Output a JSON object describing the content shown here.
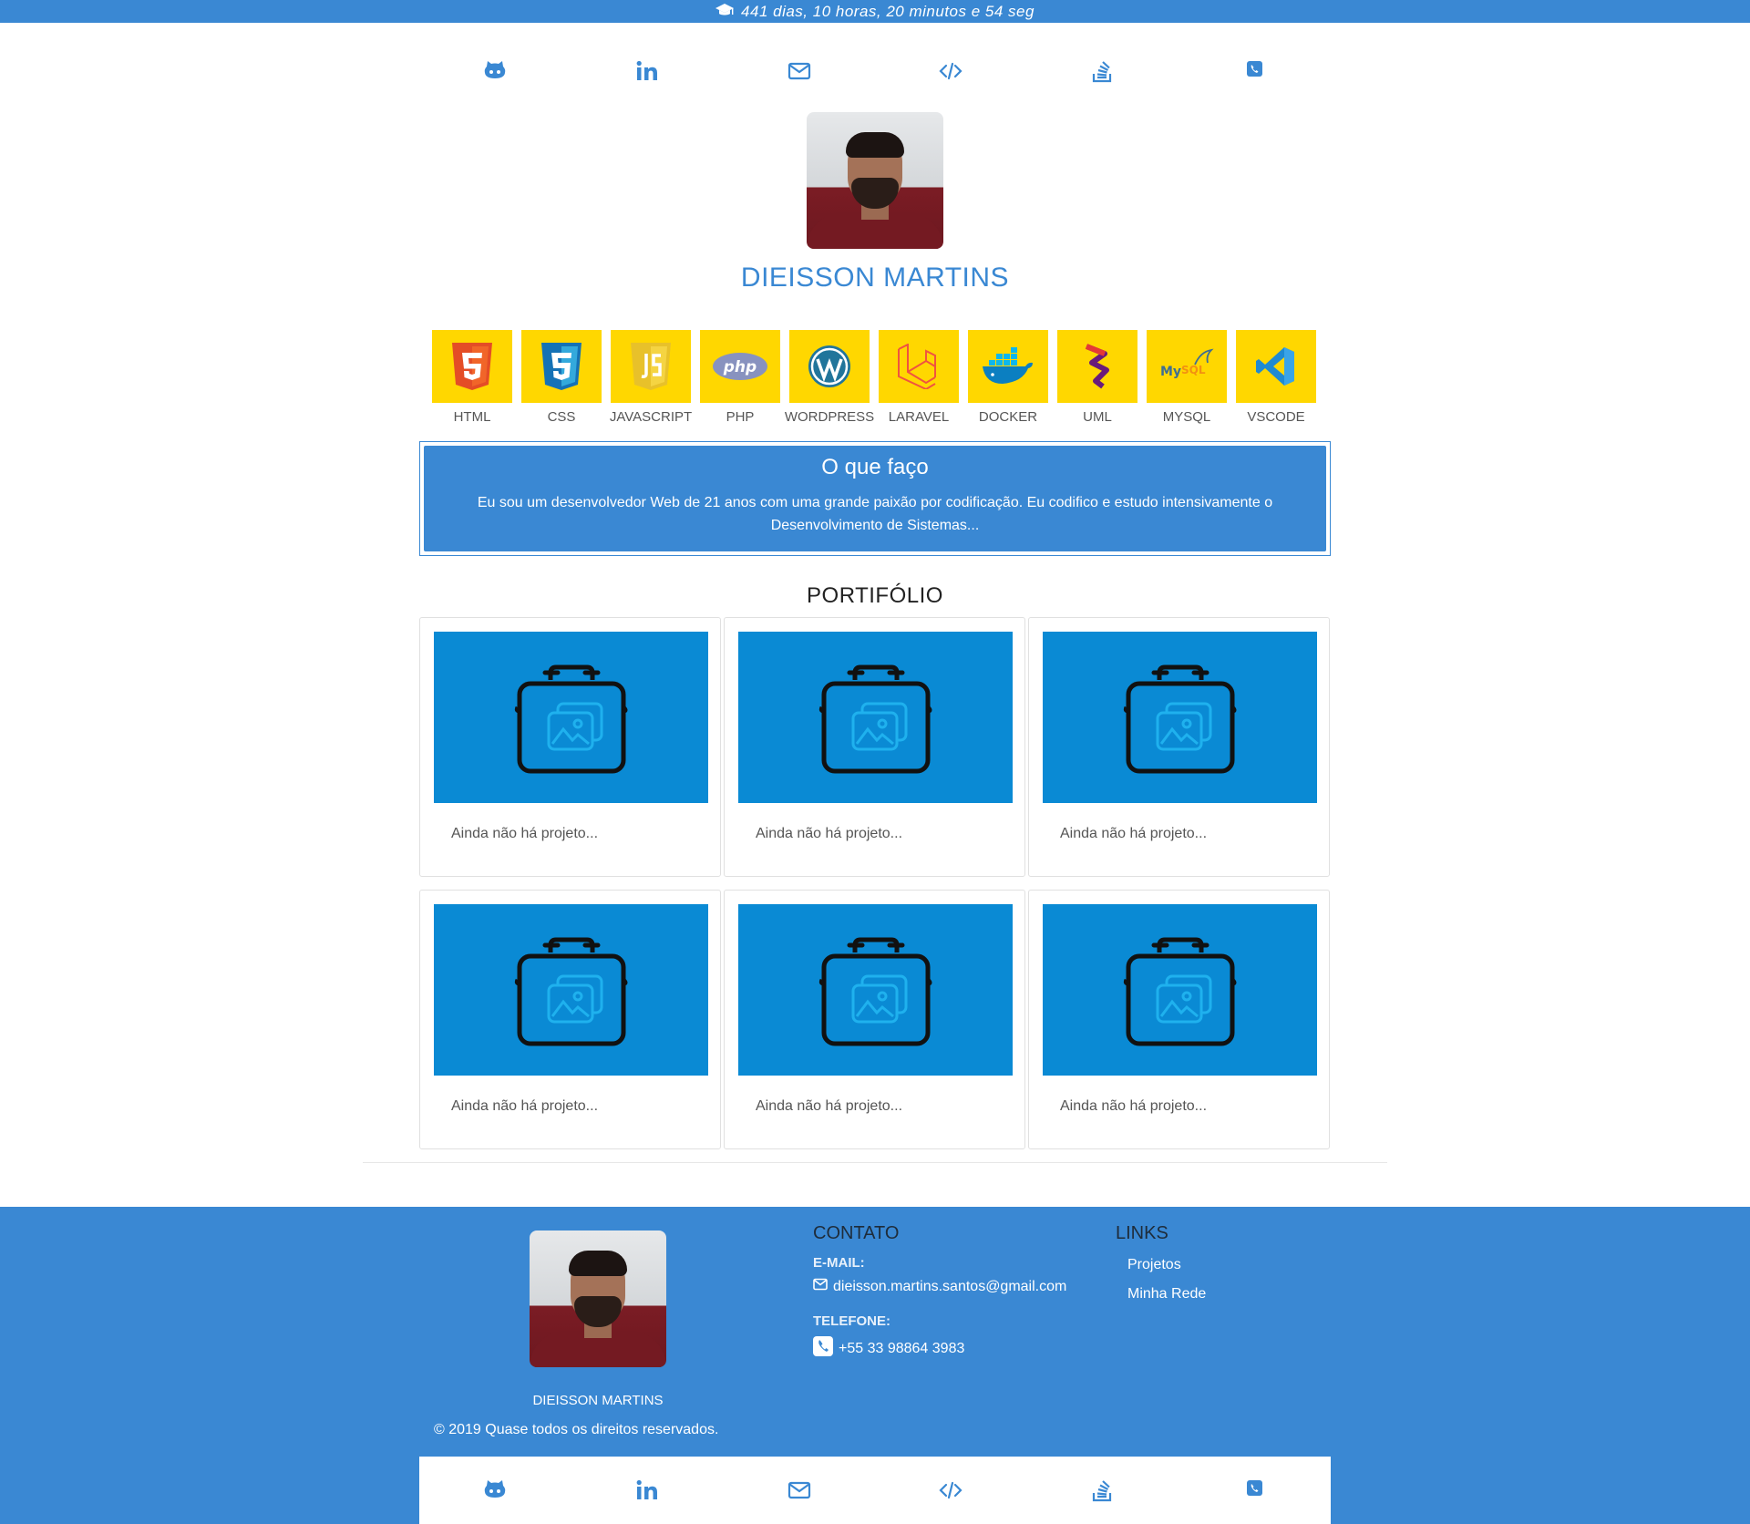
{
  "topbar": {
    "counter": "441 dias, 10 horas, 20 minutos e 54 seg",
    "icon": "graduation-cap-icon"
  },
  "social": [
    {
      "name": "github",
      "icon": "github-icon"
    },
    {
      "name": "linkedin",
      "icon": "linkedin-icon"
    },
    {
      "name": "email",
      "icon": "envelope-icon"
    },
    {
      "name": "code",
      "icon": "code-icon"
    },
    {
      "name": "stackoverflow",
      "icon": "stackoverflow-icon"
    },
    {
      "name": "phone",
      "icon": "phone-icon"
    }
  ],
  "profile": {
    "name": "DIEISSON MARTINS"
  },
  "skills": [
    {
      "label": "HTML"
    },
    {
      "label": "CSS"
    },
    {
      "label": "JAVASCRIPT"
    },
    {
      "label": "PHP"
    },
    {
      "label": "WORDPRESS"
    },
    {
      "label": "LARAVEL"
    },
    {
      "label": "DOCKER"
    },
    {
      "label": "UML"
    },
    {
      "label": "MYSQL"
    },
    {
      "label": "VSCODE"
    }
  ],
  "about": {
    "title": "O que faço",
    "text": "Eu sou um desenvolvedor Web de 21 anos com uma grande paixão por codificação. Eu codifico e estudo intensivamente o Desenvolvimento de Sistemas..."
  },
  "portfolio": {
    "title": "PORTIFÓLIO",
    "cards": [
      {
        "caption": "Ainda não há projeto..."
      },
      {
        "caption": "Ainda não há projeto..."
      },
      {
        "caption": "Ainda não há projeto..."
      },
      {
        "caption": "Ainda não há projeto..."
      },
      {
        "caption": "Ainda não há projeto..."
      },
      {
        "caption": "Ainda não há projeto..."
      }
    ]
  },
  "footer": {
    "name": "DIEISSON MARTINS",
    "copyright": "©  2019 Quase todos os direitos reservados.",
    "contact": {
      "title": "CONTATO",
      "email_label": "E-MAIL:",
      "email": "dieisson.martins.santos@gmail.com",
      "phone_label": "TELEFONE:",
      "phone": "+55 33 98864 3983"
    },
    "links": {
      "title": "LINKS",
      "items": [
        "Projetos",
        "Minha Rede"
      ]
    }
  },
  "colors": {
    "accent": "#3a88d3",
    "tile": "#ffd700",
    "card_thumb": "#0a8ad4"
  }
}
